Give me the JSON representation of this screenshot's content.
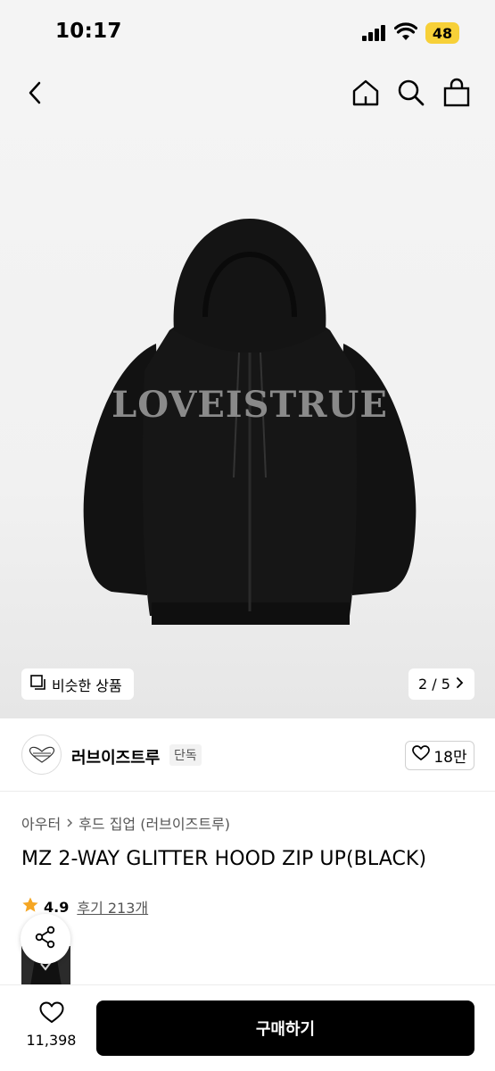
{
  "status_bar": {
    "time": "10:17",
    "battery": "48"
  },
  "gallery": {
    "similar_label": "비슷한 상품",
    "page_indicator": "2 / 5"
  },
  "brand": {
    "name": "러브이즈트루",
    "badge": "단독",
    "like_count": "18만"
  },
  "product": {
    "breadcrumb": [
      "아우터",
      "후드 집업 (러브이즈트루)"
    ],
    "title": "MZ 2-WAY GLITTER HOOD ZIP UP(BLACK)",
    "rating": "4.9",
    "review_label": "후기 213개",
    "graphic_text": "LOVEISTRUE"
  },
  "bottom_bar": {
    "wish_count": "11,398",
    "buy_label": "구매하기"
  },
  "icons": [
    "back-arrow-icon",
    "home-icon",
    "search-icon",
    "shopping-bag-icon",
    "similar-icon",
    "chevron-right-icon",
    "heart-icon",
    "star-icon",
    "share-icon"
  ],
  "colors": {
    "accent": "#000000",
    "star": "#f5a623"
  }
}
